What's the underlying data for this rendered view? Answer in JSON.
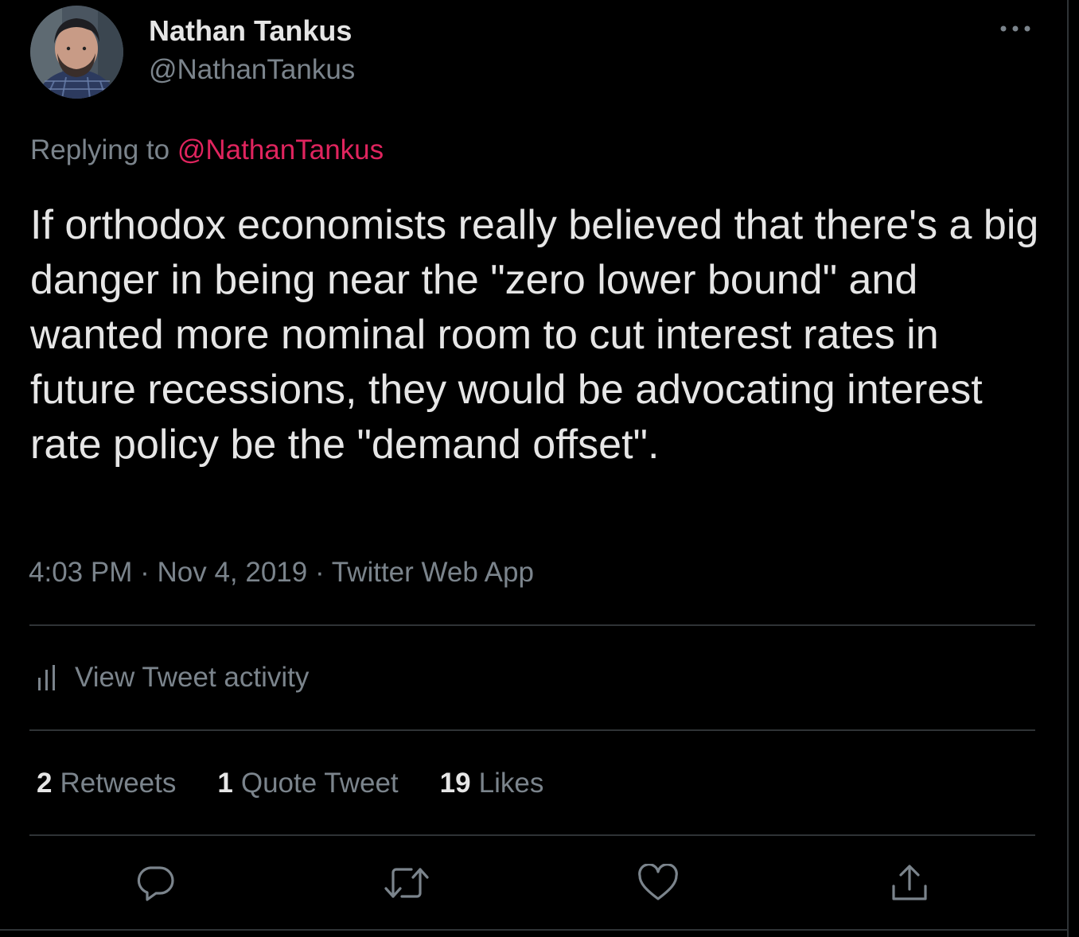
{
  "author": {
    "name": "Nathan Tankus",
    "handle": "@NathanTankus"
  },
  "reply": {
    "prefix": "Replying to",
    "mention": "@NathanTankus"
  },
  "tweet": {
    "text": "If orthodox economists really believed that there's a big danger in being near the \"zero lower bound\" and wanted more nominal room to cut interest rates in future recessions, they would be advocating interest rate policy be the \"demand offset\"."
  },
  "meta": {
    "time": "4:03 PM",
    "date": "Nov 4, 2019",
    "source": "Twitter Web App",
    "separator": "·"
  },
  "activity": {
    "label": "View Tweet activity"
  },
  "stats": {
    "retweets": {
      "count": "2",
      "label": "Retweets"
    },
    "quotes": {
      "count": "1",
      "label": "Quote Tweet"
    },
    "likes": {
      "count": "19",
      "label": "Likes"
    }
  },
  "icons": {
    "more": "more-horizontal-icon",
    "activity": "bar-chart-icon",
    "reply": "reply-bubble-icon",
    "retweet": "retweet-icon",
    "like": "heart-icon",
    "share": "share-icon"
  },
  "colors": {
    "background": "#000000",
    "text": "#e6e6e6",
    "secondary": "#7b848c",
    "mention": "#e0245e",
    "divider": "#2f3336"
  }
}
